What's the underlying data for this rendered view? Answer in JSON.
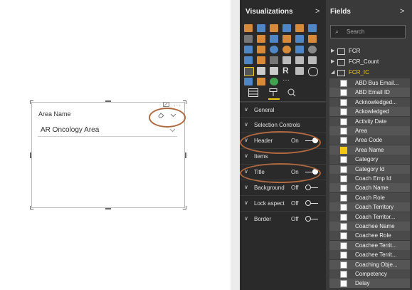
{
  "canvas": {
    "slicer": {
      "header_label": "Area Name",
      "selected_value": "AR Oncology Area",
      "more_options_icon": "ellipsis-icon",
      "focus_icon": "focus-mode-icon",
      "eraser_icon": "eraser-icon",
      "chevron_icon": "chevron-down-icon"
    }
  },
  "visualizations": {
    "title": "Visualizations",
    "arrow": ">",
    "sections": [
      {
        "label": "General",
        "value": "",
        "toggle": null
      },
      {
        "label": "Selection Controls",
        "value": "",
        "toggle": null
      },
      {
        "label": "Header",
        "value": "On",
        "toggle": "on"
      },
      {
        "label": "Items",
        "value": "",
        "toggle": null
      },
      {
        "label": "Title",
        "value": "On",
        "toggle": "on"
      },
      {
        "label": "Background",
        "value": "Off",
        "toggle": "off"
      },
      {
        "label": "Lock aspect",
        "value": "Off",
        "toggle": "off"
      },
      {
        "label": "Border",
        "value": "Off",
        "toggle": "off"
      }
    ],
    "toggle_on": "On",
    "toggle_off": "Off"
  },
  "fields": {
    "title": "Fields",
    "arrow": ">",
    "search_placeholder": "Search",
    "tables": [
      {
        "label": "FCR",
        "expanded": false
      },
      {
        "label": "FCR_Count",
        "expanded": false
      },
      {
        "label": "FCR_IC",
        "expanded": true
      }
    ],
    "items": [
      {
        "label": "ABD Bus Email...",
        "checked": false
      },
      {
        "label": "ABD Email ID",
        "checked": false
      },
      {
        "label": "Acknowledged...",
        "checked": false
      },
      {
        "label": "Ackowledged",
        "checked": false
      },
      {
        "label": "Activity Date",
        "checked": false
      },
      {
        "label": "Area",
        "checked": false
      },
      {
        "label": "Area Code",
        "checked": false
      },
      {
        "label": "Area Name",
        "checked": true
      },
      {
        "label": "Category",
        "checked": false
      },
      {
        "label": "Category Id",
        "checked": false
      },
      {
        "label": "Coach Emp Id",
        "checked": false
      },
      {
        "label": "Coach Name",
        "checked": false
      },
      {
        "label": "Coach Role",
        "checked": false
      },
      {
        "label": "Coach Territory",
        "checked": false
      },
      {
        "label": "Coach Territor...",
        "checked": false
      },
      {
        "label": "Coachee Name",
        "checked": false
      },
      {
        "label": "Coachee Role",
        "checked": false
      },
      {
        "label": "Coachee Territ...",
        "checked": false
      },
      {
        "label": "Coachee Territ...",
        "checked": false
      },
      {
        "label": "Coaching Obje...",
        "checked": false
      },
      {
        "label": "Competency",
        "checked": false
      },
      {
        "label": "Delay",
        "checked": false
      }
    ]
  },
  "colors": {
    "accent_oval": "#b0683f",
    "checked": "#f2c811",
    "viz_bg": "#2a2a2a",
    "fields_bg": "#3a3a3a"
  }
}
